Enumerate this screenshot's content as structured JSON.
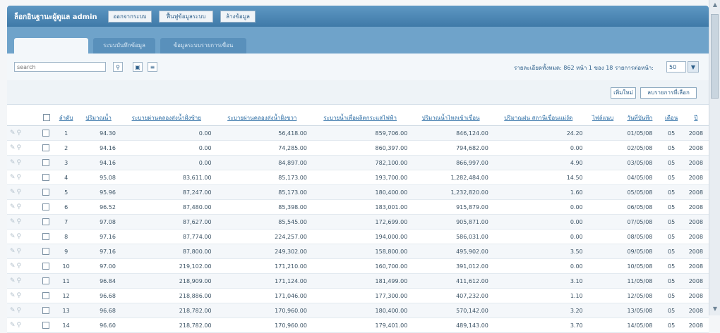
{
  "topbar": {
    "login_text": "ล็อกอินฐานะผู้ดูแล  admin",
    "buttons": [
      "ออกจากระบบ",
      "ฟื้นฟูข้อมูลระบบ",
      "ล้างข้อมูล"
    ]
  },
  "tabs": [
    "ระบบตรวจสอบหน้า",
    "ระบบบันทึกข้อมูล",
    "ข้อมูลระบบรายการเขื่อน"
  ],
  "toolbar": {
    "search_placeholder": "search",
    "search_icon": "magnifier-icon",
    "record_info": "รายละเอียดทั้งหมด: 862  หน้า 1 ของ 18",
    "per_page_label": "รายการต่อหน้า:",
    "per_page_value": "50"
  },
  "actions": {
    "add_label": "เพิ่มใหม่",
    "delete_label": "ลบรายการที่เลือก"
  },
  "table": {
    "headers": [
      "ลำดับ",
      "ปริมาณน้ำ",
      "ระบายผ่านคลองส่งน้ำฝั่งซ้าย",
      "ระบายผ่านคลองส่งน้ำฝั่งขวา",
      "ระบายน้ำเพื่อผลิตกระแสไฟฟ้า",
      "ปริมาณน้ำไหลเข้าเขื่อน",
      "ปริมาณฝน สถานีเขื่อนแม่งัด",
      "ไฟล์แนบ",
      "วันที่บันทึก",
      "เดือน",
      "ปี"
    ],
    "rows": [
      [
        "1",
        "94.30",
        "0.00",
        "56,418.00",
        "859,706.00",
        "846,124.00",
        "24.20",
        "",
        "01/05/08",
        "05",
        "2008"
      ],
      [
        "2",
        "94.16",
        "0.00",
        "74,285.00",
        "860,397.00",
        "794,682.00",
        "0.00",
        "",
        "02/05/08",
        "05",
        "2008"
      ],
      [
        "3",
        "94.16",
        "0.00",
        "84,897.00",
        "782,100.00",
        "866,997.00",
        "4.90",
        "",
        "03/05/08",
        "05",
        "2008"
      ],
      [
        "4",
        "95.08",
        "83,611.00",
        "85,173.00",
        "193,700.00",
        "1,282,484.00",
        "14.50",
        "",
        "04/05/08",
        "05",
        "2008"
      ],
      [
        "5",
        "95.96",
        "87,247.00",
        "85,173.00",
        "180,400.00",
        "1,232,820.00",
        "1.60",
        "",
        "05/05/08",
        "05",
        "2008"
      ],
      [
        "6",
        "96.52",
        "87,480.00",
        "85,398.00",
        "183,001.00",
        "915,879.00",
        "0.00",
        "",
        "06/05/08",
        "05",
        "2008"
      ],
      [
        "7",
        "97.08",
        "87,627.00",
        "85,545.00",
        "172,699.00",
        "905,871.00",
        "0.00",
        "",
        "07/05/08",
        "05",
        "2008"
      ],
      [
        "8",
        "97.16",
        "87,774.00",
        "224,257.00",
        "194,000.00",
        "586,031.00",
        "0.00",
        "",
        "08/05/08",
        "05",
        "2008"
      ],
      [
        "9",
        "97.16",
        "87,800.00",
        "249,302.00",
        "158,800.00",
        "495,902.00",
        "3.50",
        "",
        "09/05/08",
        "05",
        "2008"
      ],
      [
        "10",
        "97.00",
        "219,102.00",
        "171,210.00",
        "160,700.00",
        "391,012.00",
        "0.00",
        "",
        "10/05/08",
        "05",
        "2008"
      ],
      [
        "11",
        "96.84",
        "218,909.00",
        "171,124.00",
        "181,499.00",
        "411,612.00",
        "3.10",
        "",
        "11/05/08",
        "05",
        "2008"
      ],
      [
        "12",
        "96.68",
        "218,886.00",
        "171,046.00",
        "177,300.00",
        "407,232.00",
        "1.10",
        "",
        "12/05/08",
        "05",
        "2008"
      ],
      [
        "13",
        "96.68",
        "218,782.00",
        "170,960.00",
        "180,400.00",
        "570,142.00",
        "3.20",
        "",
        "13/05/08",
        "05",
        "2008"
      ],
      [
        "14",
        "96.60",
        "218,782.00",
        "170,960.00",
        "179,401.00",
        "489,143.00",
        "3.70",
        "",
        "14/05/08",
        "05",
        "2008"
      ]
    ]
  },
  "colors": {
    "header_bar": "#4a86b4",
    "tab_bar": "#6fa3ca",
    "link": "#2d6ea5"
  }
}
